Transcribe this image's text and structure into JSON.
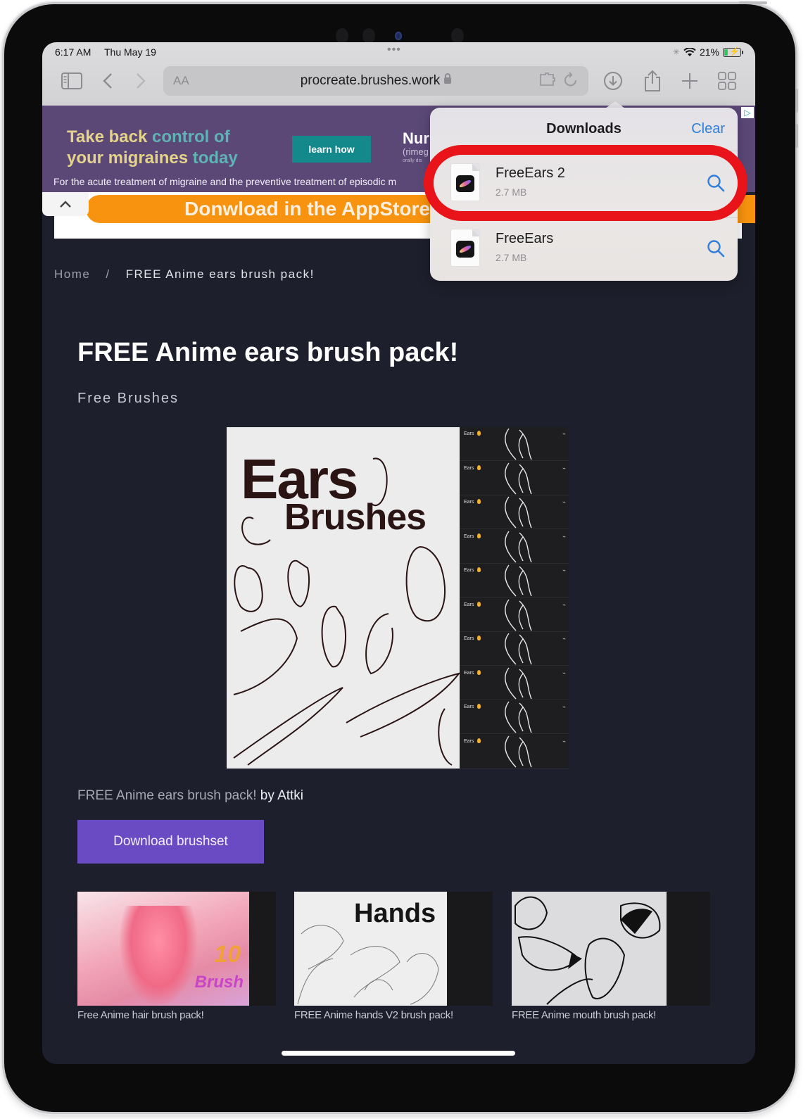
{
  "status_bar": {
    "time": "6:17 AM",
    "date": "Thu May 19",
    "multitask_dots": "•••",
    "battery_percent": "21%",
    "battery_level": 0.21,
    "charging": true
  },
  "browser": {
    "text_size_label": "AA",
    "url": "procreate.brushes.work",
    "secure": true,
    "icons": [
      "sidebar-icon",
      "back-icon",
      "forward-icon",
      "extension-icon",
      "reload-icon",
      "downloads-icon",
      "share-icon",
      "new-tab-icon",
      "tab-overview-icon"
    ]
  },
  "ad": {
    "headline_line1_a": "Take back ",
    "headline_line1_b": "control of",
    "headline_line2_a": "your migraines ",
    "headline_line2_b": "today",
    "cta": "learn how",
    "brand": "Nur",
    "brand_sub": "(rimeg",
    "brand_sub2": "orally dis",
    "disclaimer": "For the acute treatment of migraine and the preventive treatment of episodic m"
  },
  "appstore_banner": {
    "label": "Donwload in the AppStore"
  },
  "breadcrumb": {
    "home": "Home",
    "separator": "/",
    "current": "FREE Anime ears brush pack!"
  },
  "page": {
    "title": "FREE Anime ears brush pack!",
    "category": "Free Brushes",
    "hero": {
      "title_line1": "Ears",
      "title_line2": "Brushes",
      "brush_label": "Ears",
      "brush_rows": 10
    },
    "credit_title": "FREE Anime ears brush pack!",
    "credit_author": "by Attki",
    "download_button": "Download brushset"
  },
  "related": [
    {
      "caption": "Free Anime hair brush pack!",
      "thumb_text": "10 Brush"
    },
    {
      "caption": "FREE Anime hands V2 brush pack!",
      "thumb_text": "Hands"
    },
    {
      "caption": "FREE Anime mouth brush pack!",
      "thumb_text": ""
    }
  ],
  "downloads_popover": {
    "title": "Downloads",
    "clear_label": "Clear",
    "items": [
      {
        "name": "FreeEars 2",
        "size": "2.7 MB",
        "highlighted": true
      },
      {
        "name": "FreeEars",
        "size": "2.7 MB",
        "highlighted": false
      }
    ]
  },
  "colors": {
    "page_background": "#1d1f2c",
    "download_button": "#6a4bc4",
    "ad_background": "#5b4877",
    "appstore_orange": "#f7930f",
    "link_blue": "#2f7fd8",
    "highlight_red": "#e8141a"
  }
}
